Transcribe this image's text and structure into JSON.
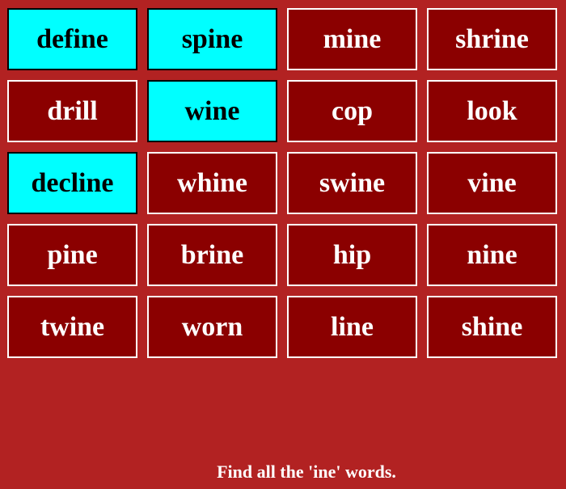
{
  "colors": {
    "background": "#b22222",
    "tile_default": "#8b0000",
    "tile_selected": "#00ffff"
  },
  "tiles": [
    {
      "word": "define",
      "selected": true
    },
    {
      "word": "spine",
      "selected": true
    },
    {
      "word": "mine",
      "selected": false
    },
    {
      "word": "shrine",
      "selected": false
    },
    {
      "word": "drill",
      "selected": false
    },
    {
      "word": "wine",
      "selected": true
    },
    {
      "word": "cop",
      "selected": false
    },
    {
      "word": "look",
      "selected": false
    },
    {
      "word": "decline",
      "selected": true
    },
    {
      "word": "whine",
      "selected": false
    },
    {
      "word": "swine",
      "selected": false
    },
    {
      "word": "vine",
      "selected": false
    },
    {
      "word": "pine",
      "selected": false
    },
    {
      "word": "brine",
      "selected": false
    },
    {
      "word": "hip",
      "selected": false
    },
    {
      "word": "nine",
      "selected": false
    },
    {
      "word": "twine",
      "selected": false
    },
    {
      "word": "worn",
      "selected": false
    },
    {
      "word": "line",
      "selected": false
    },
    {
      "word": "shine",
      "selected": false
    }
  ],
  "instruction": "Find all the 'ine' words."
}
